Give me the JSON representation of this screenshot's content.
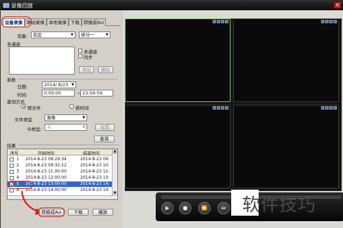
{
  "window": {
    "title": "录像回放",
    "close_glyph": "✕"
  },
  "tabs": [
    {
      "label": "设备录像",
      "active": true
    },
    {
      "label": "联动录像",
      "active": false
    },
    {
      "label": "本地录像",
      "active": false
    },
    {
      "label": "下载",
      "active": false
    },
    {
      "label": "转换成Avi",
      "active": false
    }
  ],
  "device": {
    "label": "设备:",
    "value": "名区",
    "extra_value": "拼分一"
  },
  "multichannel": {
    "label": "多通道",
    "check_multi": "多通道",
    "check_sync": "同步",
    "add_button": "添加",
    "delete_button": "删除"
  },
  "params": {
    "label": "参数",
    "date_label": "日期:",
    "date_value": "2014/ 8/23",
    "time_label": "时间:",
    "time_start": "0:00:00",
    "time_end": "23:59:59",
    "query_mode_label": "查询方式",
    "radio_by_file": "按文件",
    "radio_by_time": "按时间",
    "file_type_label": "文件类型",
    "file_type_value": "录像",
    "card_type_label": "卡类型:",
    "card_type_value": "卡",
    "config_button": "配置",
    "query_button": "查询"
  },
  "results": {
    "label": "结果",
    "columns": [
      "序号",
      "开始时间",
      "结束时间"
    ],
    "rows": [
      {
        "no": "1",
        "start": "2014-8-23 09:29:34",
        "end": "2014-8-23 09:",
        "selected": false
      },
      {
        "no": "2",
        "start": "2014-8-23 09:32:22",
        "end": "2014-8-23 10:",
        "selected": false
      },
      {
        "no": "3",
        "start": "2014-8-23 11:00:00",
        "end": "2014-8-23 12:",
        "selected": false
      },
      {
        "no": "4",
        "start": "2014-8-23 12:00:00",
        "end": "2014-8-23 13:",
        "selected": false
      },
      {
        "no": "5",
        "start": "2014-8-23 13:00:00",
        "end": "2014-8-23 14:",
        "selected": true
      },
      {
        "no": "6",
        "start": "2014-8-23 14:00:00",
        "end": "2014-8-23 14:",
        "selected": false
      }
    ]
  },
  "bottom_buttons": {
    "convert": "转换成Avi",
    "download": "下载",
    "play": "播放"
  },
  "player_buttons": [
    "▶",
    "■",
    "⏩",
    "⏭",
    "🔊"
  ],
  "watermark": "软件技巧",
  "colors": {
    "selection": "#3169c6",
    "annotation": "#e0201c",
    "active_pane": "#6ad34a"
  }
}
